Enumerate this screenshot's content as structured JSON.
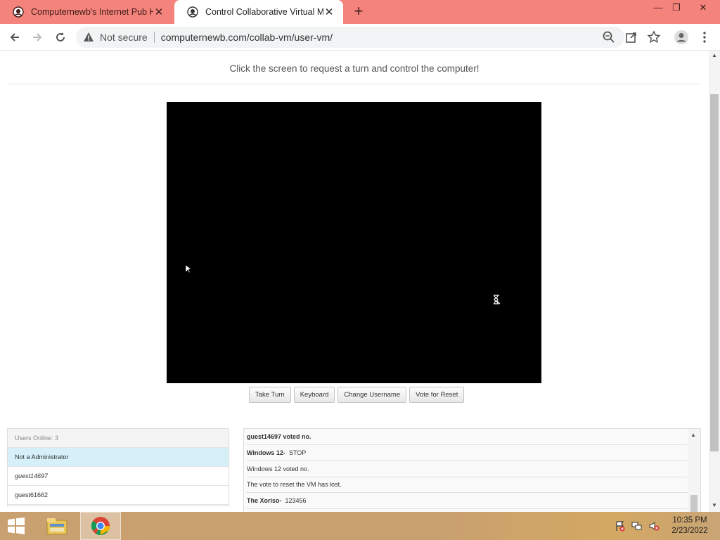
{
  "browser": {
    "tabs": [
      {
        "title": "Computernewb's Internet Pub Hub",
        "active": false
      },
      {
        "title": "Control Collaborative Virtual Machine",
        "active": true
      }
    ],
    "new_tab_label": "+",
    "window_controls": {
      "minimize": "—",
      "restore": "❐",
      "close": "✕"
    },
    "security_label": "Not secure",
    "url": "computernewb.com/collab-vm/user-vm/"
  },
  "page": {
    "instruction": "Click the screen to request a turn and control the computer!",
    "buttons": {
      "take_turn": "Take Turn",
      "keyboard": "Keyboard",
      "change_username": "Change Username",
      "vote_reset": "Vote for Reset"
    },
    "users_panel": {
      "header": "Users Online: 3",
      "status": "Not a Administrator",
      "users": [
        "guest14697",
        "guest61662"
      ]
    },
    "chat": [
      {
        "user": "",
        "text": "guest14697 voted no.",
        "bold_all": true
      },
      {
        "user": "Windows 12-",
        "text": "STOP",
        "bold_all": false
      },
      {
        "user": "",
        "text": "Windows 12 voted no.",
        "bold_all": false
      },
      {
        "user": "",
        "text": "The vote to reset the VM has lost.",
        "bold_all": false
      },
      {
        "user": "The Xoriso-",
        "text": "123456",
        "bold_all": false
      }
    ]
  },
  "taskbar": {
    "time": "10:35 PM",
    "date": "2/23/2022",
    "pinned": [
      "file-explorer",
      "chrome"
    ]
  },
  "colors": {
    "tab_strip": "#f4837b",
    "vm_screen": "#000000",
    "admin_row": "#d6f0f9"
  }
}
